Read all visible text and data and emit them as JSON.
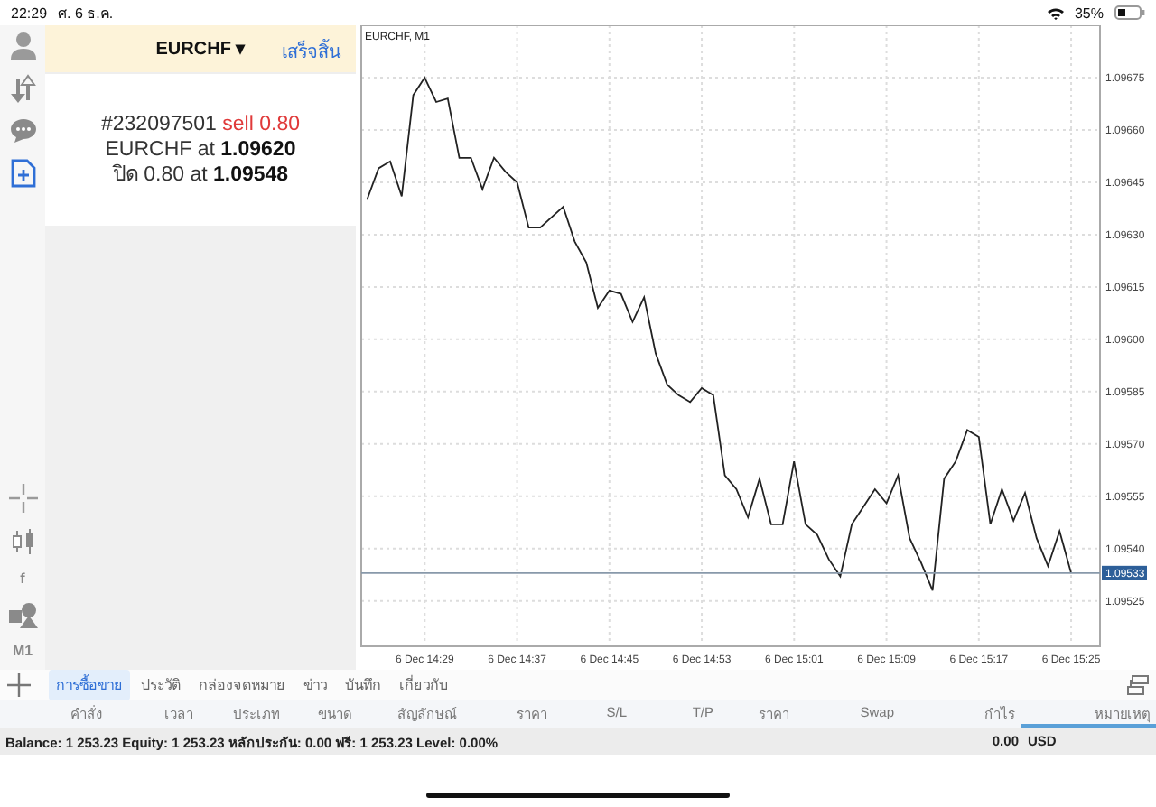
{
  "status_bar": {
    "time": "22:29",
    "date": "ศ. 6 ธ.ค.",
    "battery": "35%"
  },
  "side_toolbar": {
    "top": [
      {
        "kind": "person"
      },
      {
        "kind": "arrows"
      },
      {
        "kind": "chat"
      },
      {
        "kind": "new-order",
        "selected": true
      }
    ],
    "bottom": [
      {
        "kind": "crosshair"
      },
      {
        "kind": "candles"
      },
      {
        "kind": "text",
        "label": "f"
      },
      {
        "kind": "shapes"
      },
      {
        "kind": "text",
        "label": "M1"
      }
    ]
  },
  "order_panel": {
    "symbol": "EURCHF",
    "caret": "▾",
    "done": "เสร็จสิ้น",
    "ticket": "#232097501",
    "action": "sell 0.80",
    "lines": [
      "EURCHF at **1.09620**",
      "ปิด 0.80 at **1.09548**"
    ]
  },
  "chart": {
    "chart_data": {
      "type": "line",
      "title": "EURCHF, M1",
      "grid": true,
      "ref_lines": [
        {
          "axis": "y",
          "value": 1.09533,
          "label": "1.09533"
        }
      ],
      "categories": [
        null,
        null,
        null,
        null,
        null,
        "6 Dec 14:29",
        null,
        null,
        null,
        null,
        null,
        null,
        null,
        "6 Dec 14:37",
        null,
        null,
        null,
        null,
        null,
        null,
        null,
        "6 Dec 14:45",
        null,
        null,
        null,
        null,
        null,
        null,
        null,
        "6 Dec 14:53",
        null,
        null,
        null,
        null,
        null,
        null,
        null,
        "6 Dec 15:01",
        null,
        null,
        null,
        null,
        null,
        null,
        null,
        "6 Dec 15:09",
        null,
        null,
        null,
        null,
        null,
        null,
        null,
        "6 Dec 15:17",
        null,
        null,
        null,
        null,
        null,
        null,
        null,
        "6 Dec 15:25"
      ],
      "series": [
        {
          "color": "#222222",
          "values": [
            1.0964,
            1.09649,
            1.09651,
            1.09641,
            1.0967,
            1.09675,
            1.09668,
            1.09669,
            1.09652,
            1.09652,
            1.09643,
            1.09652,
            1.09648,
            1.09645,
            1.09632,
            1.09632,
            1.09635,
            1.09638,
            1.09628,
            1.09622,
            1.09609,
            1.09614,
            1.09613,
            1.09605,
            1.09612,
            1.09596,
            1.09587,
            1.09584,
            1.09582,
            1.09586,
            1.09584,
            1.09561,
            1.09557,
            1.09549,
            1.0956,
            1.09547,
            1.09547,
            1.09565,
            1.09547,
            1.09544,
            1.09537,
            1.09532,
            1.09547,
            1.09552,
            1.09557,
            1.09553,
            1.09561,
            1.09543,
            1.09536,
            1.09528,
            1.0956,
            1.09565,
            1.09574,
            1.09572,
            1.09547,
            1.09557,
            1.09548,
            1.09556,
            1.09543,
            1.09535,
            1.09545,
            1.09533
          ]
        }
      ],
      "ylim": [
        1.09512,
        1.0969
      ],
      "yticks": [
        {
          "value": 1.09525,
          "label": "1.09525"
        },
        {
          "value": 1.0954,
          "label": "1.09540"
        },
        {
          "value": 1.09555,
          "label": "1.09555"
        },
        {
          "value": 1.0957,
          "label": "1.09570"
        },
        {
          "value": 1.09585,
          "label": "1.09585"
        },
        {
          "value": 1.096,
          "label": "1.09600"
        },
        {
          "value": 1.09615,
          "label": "1.09615"
        },
        {
          "value": 1.0963,
          "label": "1.09630"
        },
        {
          "value": 1.09645,
          "label": "1.09645"
        },
        {
          "value": 1.0966,
          "label": "1.09660"
        },
        {
          "value": 1.09675,
          "label": "1.09675"
        }
      ]
    }
  },
  "tabs": [
    {
      "label": "การซื้อขาย",
      "selected": true
    },
    {
      "label": "ประวัติ",
      "selected": false
    },
    {
      "label": "กล่องจดหมาย",
      "selected": false
    },
    {
      "label": "ข่าว",
      "selected": false
    },
    {
      "label": "บันทึก",
      "selected": false
    },
    {
      "label": "เกี่ยวกับ",
      "selected": false
    }
  ],
  "table": {
    "columns": [
      {
        "label": "คำสั่ง",
        "selected": false
      },
      {
        "label": "เวลา",
        "selected": false
      },
      {
        "label": "ประเภท",
        "selected": false
      },
      {
        "label": "ขนาด",
        "selected": false
      },
      {
        "label": "สัญลักษณ์",
        "selected": false
      },
      {
        "label": "ราคา",
        "selected": false
      },
      {
        "label": "S/L",
        "selected": false
      },
      {
        "label": "T/P",
        "selected": false
      },
      {
        "label": "ราคา",
        "selected": false
      },
      {
        "label": "Swap",
        "selected": false
      },
      {
        "label": "กำไร",
        "selected": false
      },
      {
        "label": "หมายเหตุ",
        "selected": true
      }
    ]
  },
  "balance_bar": {
    "summary": "Balance: 1 253.23 Equity: 1 253.23 หลักประกัน: 0.00 ฟรี: 1 253.23 Level: 0.00%",
    "profit": "0.00",
    "currency": "USD"
  }
}
